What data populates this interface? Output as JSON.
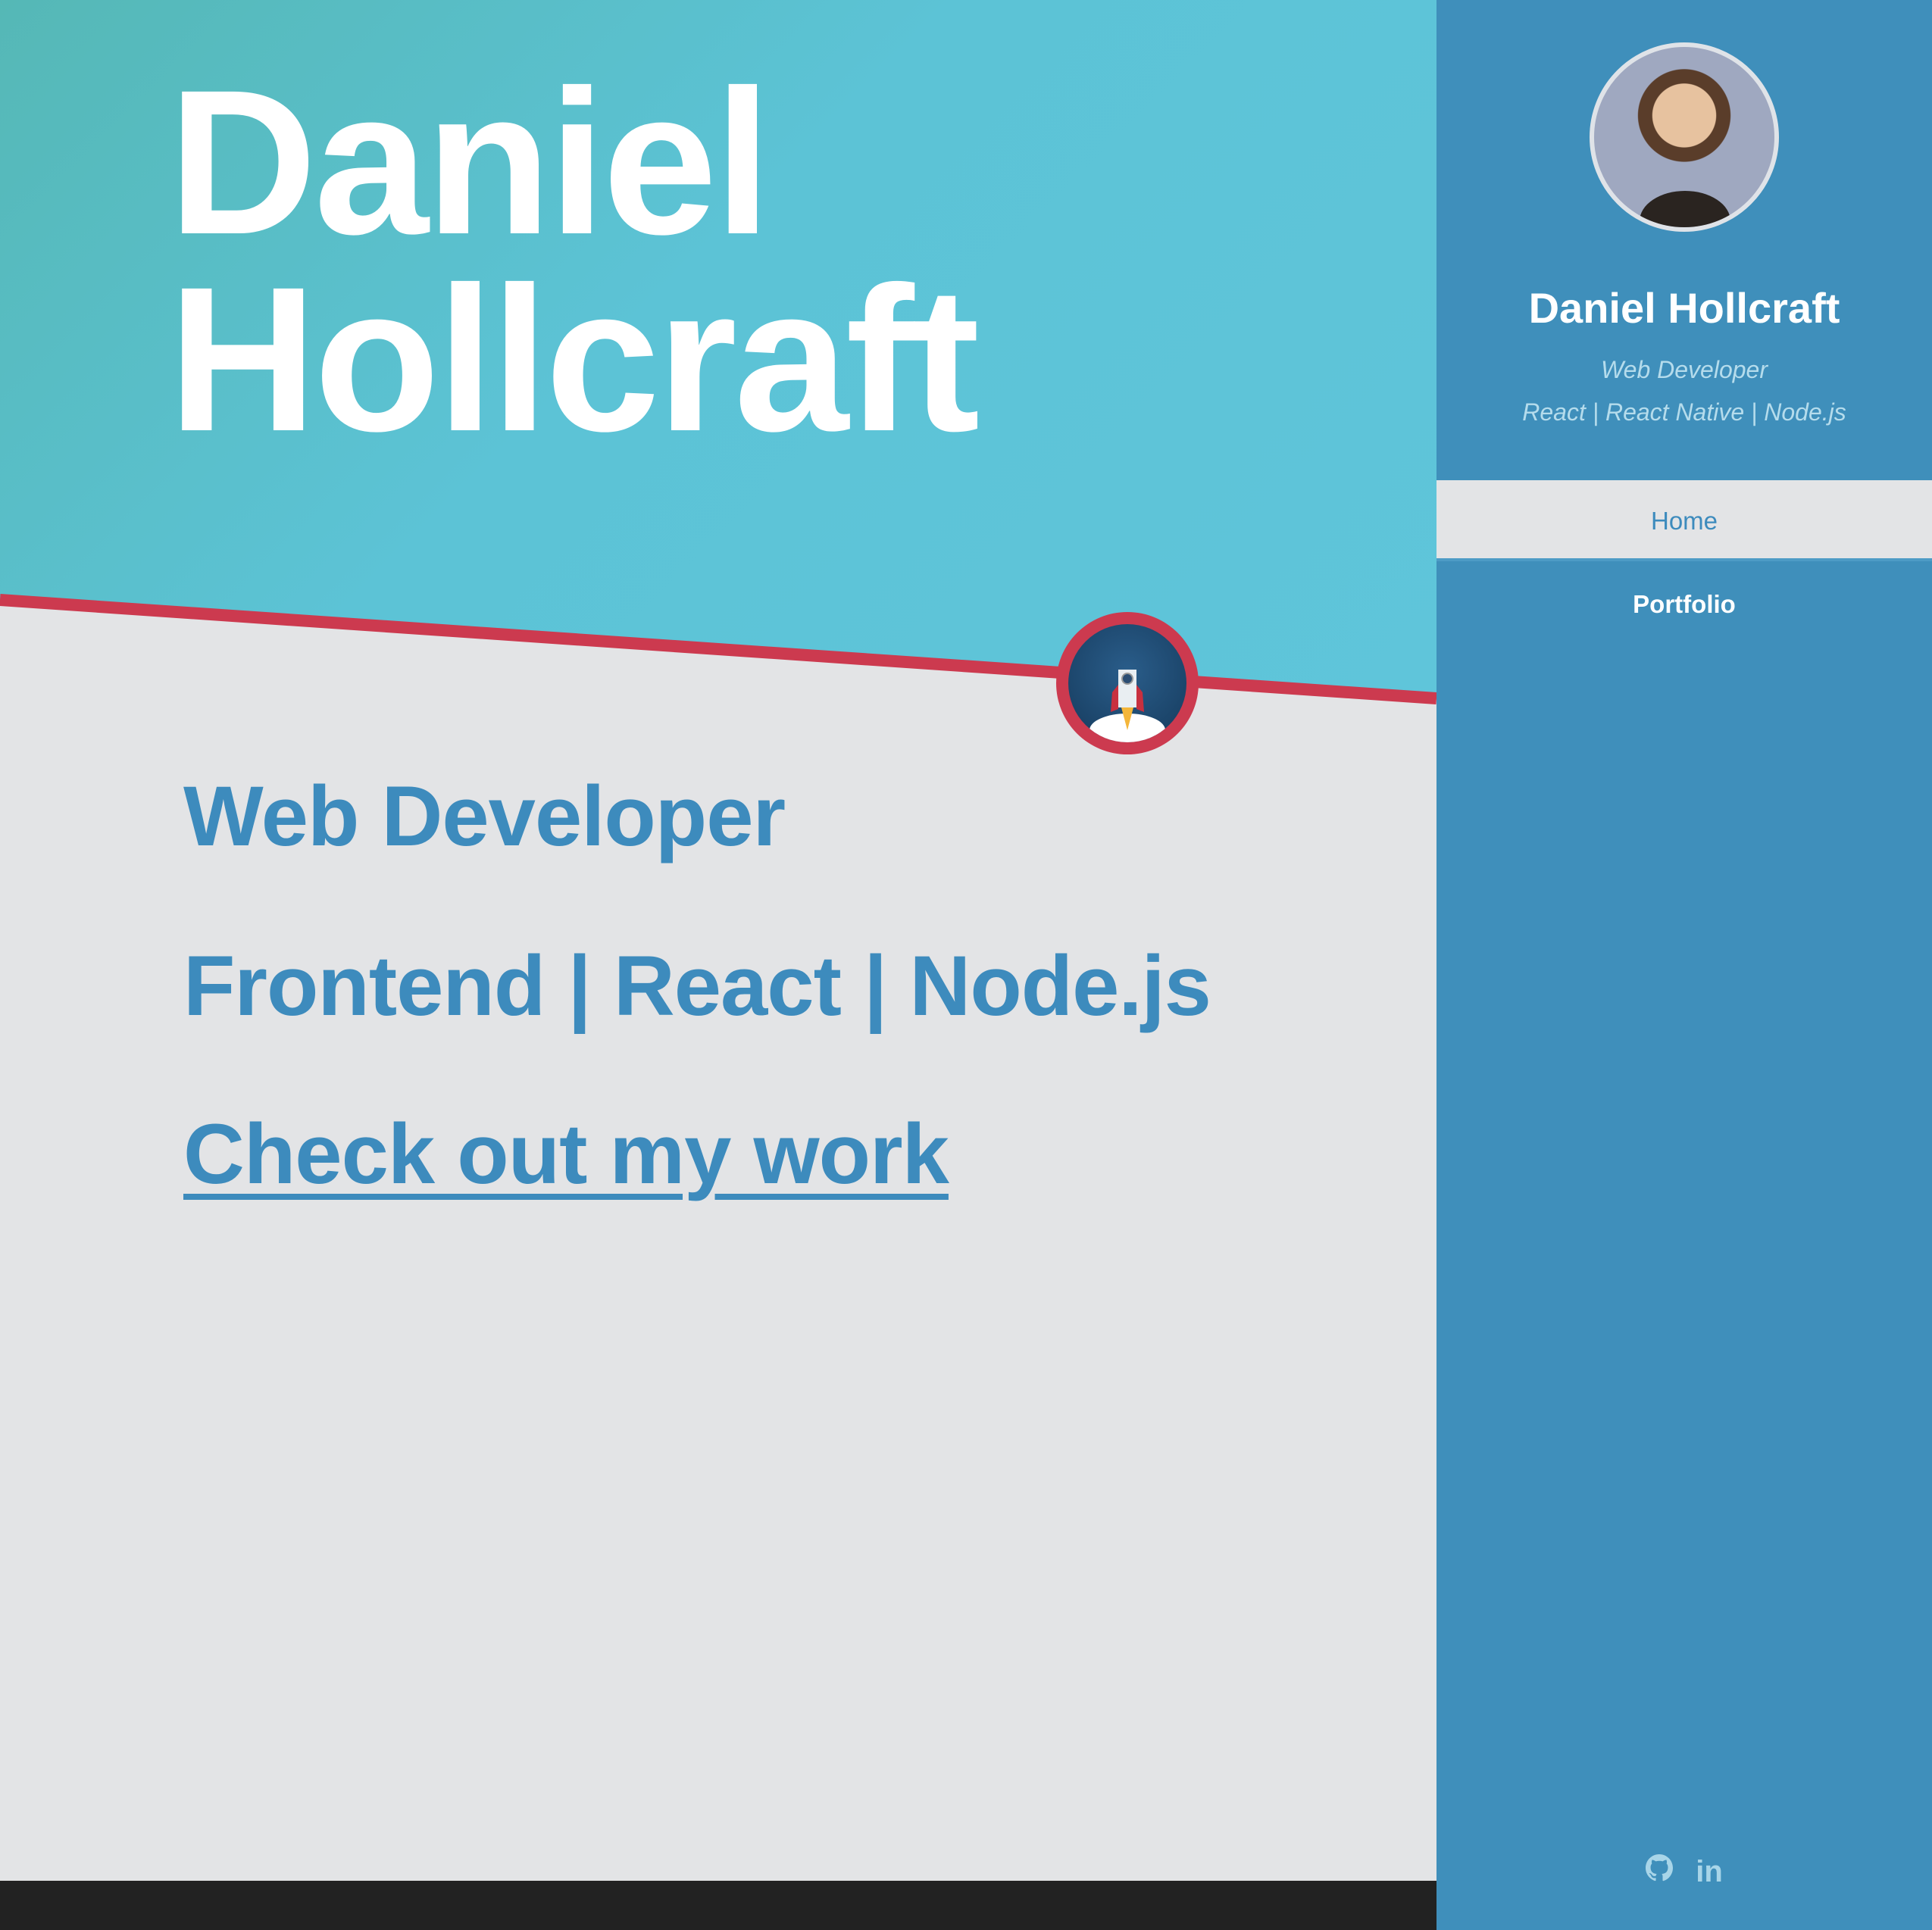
{
  "hero": {
    "first_name": "Daniel",
    "last_name": "Hollcraft"
  },
  "main": {
    "role": "Web Developer",
    "stack": "Frontend | React | Node.js",
    "cta": "Check out my work"
  },
  "sidebar": {
    "name": "Daniel Hollcraft",
    "tagline": "Web Developer",
    "stack": "React | React Native | Node.js",
    "nav": [
      {
        "label": "Home",
        "active": true
      },
      {
        "label": "Portfolio",
        "active": false
      }
    ],
    "social": [
      {
        "icon": "github-icon"
      },
      {
        "icon": "linkedin-icon",
        "label": "in"
      }
    ]
  },
  "colors": {
    "accent": "#3d8bbd",
    "sidebar": "#3f8fbb",
    "divider": "#cc3a4f",
    "footer": "#222222"
  }
}
